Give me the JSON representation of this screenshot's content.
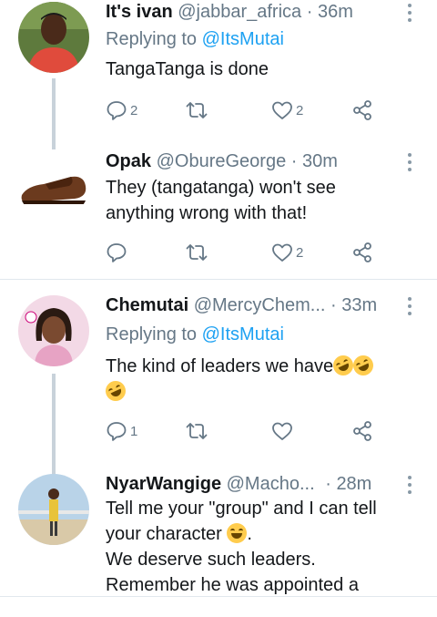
{
  "tweets": [
    {
      "name": "It's ivan",
      "handle": "@jabbar_africa",
      "time": "36m",
      "reply_prefix": "Replying to",
      "reply_to": "@ItsMutai",
      "text": "TangaTanga is done",
      "reply_count": "2",
      "retweet_count": "",
      "like_count": "2"
    },
    {
      "name": "Opak",
      "handle": "@ObureGeorge",
      "time": "30m",
      "text_line1": "They (tangatanga) won't see",
      "text_line2": "anything wrong with that!",
      "reply_count": "",
      "retweet_count": "",
      "like_count": "2"
    },
    {
      "name": "Chemutai",
      "handle": "@MercyChem...",
      "time": "33m",
      "reply_prefix": "Replying to",
      "reply_to": "@ItsMutai",
      "text": "The kind of leaders we have",
      "reply_count": "1",
      "retweet_count": "",
      "like_count": ""
    },
    {
      "name": "NyarWangige",
      "handle": "@Macho...",
      "time": "28m",
      "text_line1": "Tell me your \"group\" and I can tell",
      "text_line2": "your character",
      "text_line3": "We deserve such leaders.",
      "text_line4": "Remember he was appointed a"
    }
  ],
  "separator": "·",
  "icons": {
    "reply": "reply-icon",
    "retweet": "retweet-icon",
    "like": "heart-icon",
    "share": "share-icon",
    "menu": "more-vertical-icon"
  },
  "colors": {
    "link": "#1da1f2",
    "secondary_text": "#657786",
    "thread_line": "#c8d2da"
  }
}
